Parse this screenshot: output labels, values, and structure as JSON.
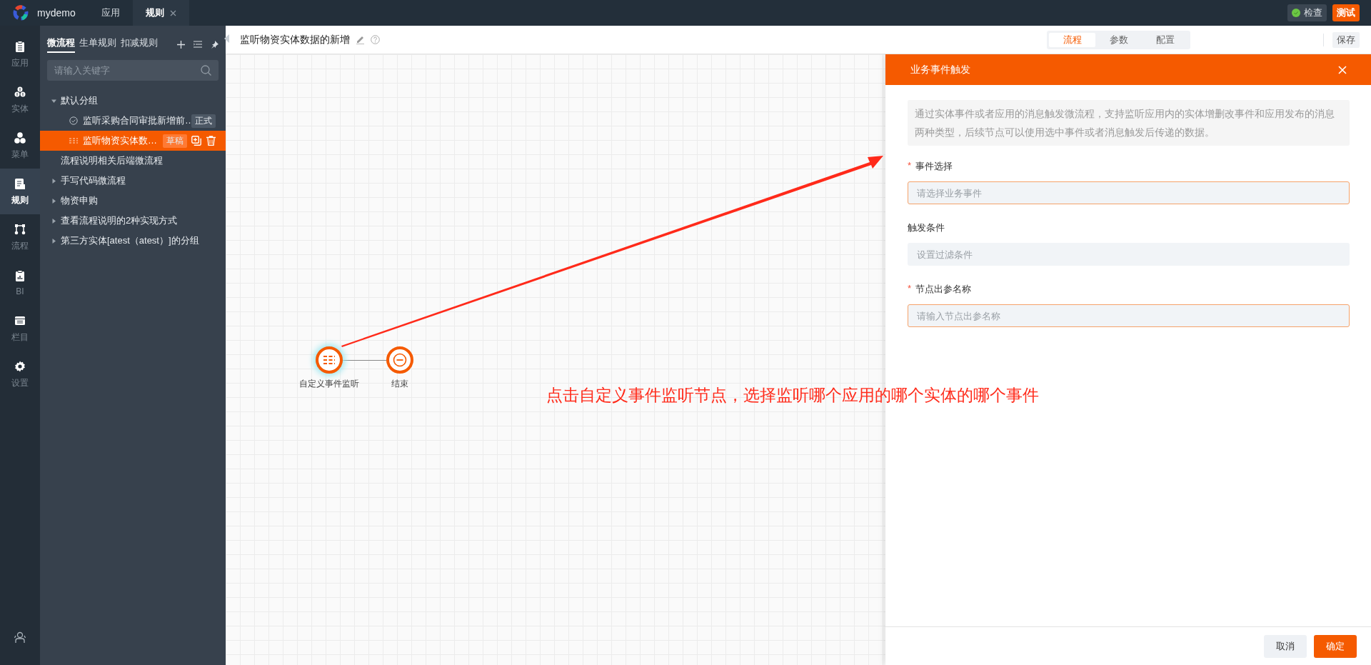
{
  "app": {
    "name": "mydemo"
  },
  "top_tabs": [
    {
      "label": "应用",
      "selected": false,
      "closable": false
    },
    {
      "label": "规则",
      "selected": true,
      "closable": true
    }
  ],
  "top_actions": [
    {
      "label": "检查",
      "kind": "check"
    },
    {
      "label": "测试",
      "kind": "primary"
    }
  ],
  "rail": [
    {
      "label": "应用",
      "selected": false
    },
    {
      "label": "实体",
      "selected": false
    },
    {
      "label": "菜单",
      "selected": false
    },
    {
      "label": "规则",
      "selected": true
    },
    {
      "label": "流程",
      "selected": false
    },
    {
      "label": "BI",
      "selected": false
    },
    {
      "label": "栏目",
      "selected": false
    },
    {
      "label": "设置",
      "selected": false
    }
  ],
  "panel": {
    "tabs": [
      {
        "label": "微流程",
        "selected": true
      },
      {
        "label": "生单规则",
        "selected": false
      },
      {
        "label": "扣减规则",
        "selected": false
      }
    ],
    "search": {
      "placeholder": "请输入关键字"
    },
    "tree": [
      {
        "label": "默认分组",
        "kind": "group",
        "expanded": true,
        "children": [
          {
            "label": "监听采购合同审批新增前…",
            "kind": "verified",
            "badge": "正式",
            "selected": false
          },
          {
            "label": "监听物资实体数…",
            "kind": "event",
            "badge": "草稿",
            "selected": true
          }
        ]
      },
      {
        "label": "流程说明相关后端微流程",
        "kind": "leaf"
      },
      {
        "label": "手写代码微流程",
        "kind": "group",
        "expanded": false
      },
      {
        "label": "物资申购",
        "kind": "group",
        "expanded": false
      },
      {
        "label": "查看流程说明的2种实现方式",
        "kind": "group",
        "expanded": false
      },
      {
        "label": "第三方实体[atest（atest）]的分组",
        "kind": "group",
        "expanded": false
      }
    ]
  },
  "editor": {
    "title": "监听物资实体数据的新增",
    "view_tabs": [
      {
        "label": "流程",
        "selected": true
      },
      {
        "label": "参数",
        "selected": false
      },
      {
        "label": "配置",
        "selected": false
      }
    ],
    "save_label": "保存"
  },
  "canvas": {
    "nodes": [
      {
        "label": "自定义事件监听",
        "kind": "event",
        "selected": true
      },
      {
        "label": "结束",
        "kind": "end",
        "selected": false
      }
    ],
    "annotation": "点击自定义事件监听节点，选择监听哪个应用的哪个实体的哪个事件"
  },
  "drawer": {
    "title": "业务事件触发",
    "description": "通过实体事件或者应用的消息触发微流程，支持监听应用内的实体增删改事件和应用发布的消息两种类型，后续节点可以使用选中事件或者消息触发后传递的数据。",
    "fields": [
      {
        "label": "事件选择",
        "marker": "*",
        "placeholder": "请选择业务事件",
        "invalid": true
      },
      {
        "label": "触发条件",
        "placeholder": "设置过滤条件",
        "invalid": false
      },
      {
        "label": "节点出参名称",
        "marker": "*",
        "placeholder": "请输入节点出参名称",
        "invalid": true
      }
    ],
    "buttons": [
      {
        "label": "取消",
        "kind": "default"
      },
      {
        "label": "确定",
        "kind": "primary"
      }
    ]
  }
}
